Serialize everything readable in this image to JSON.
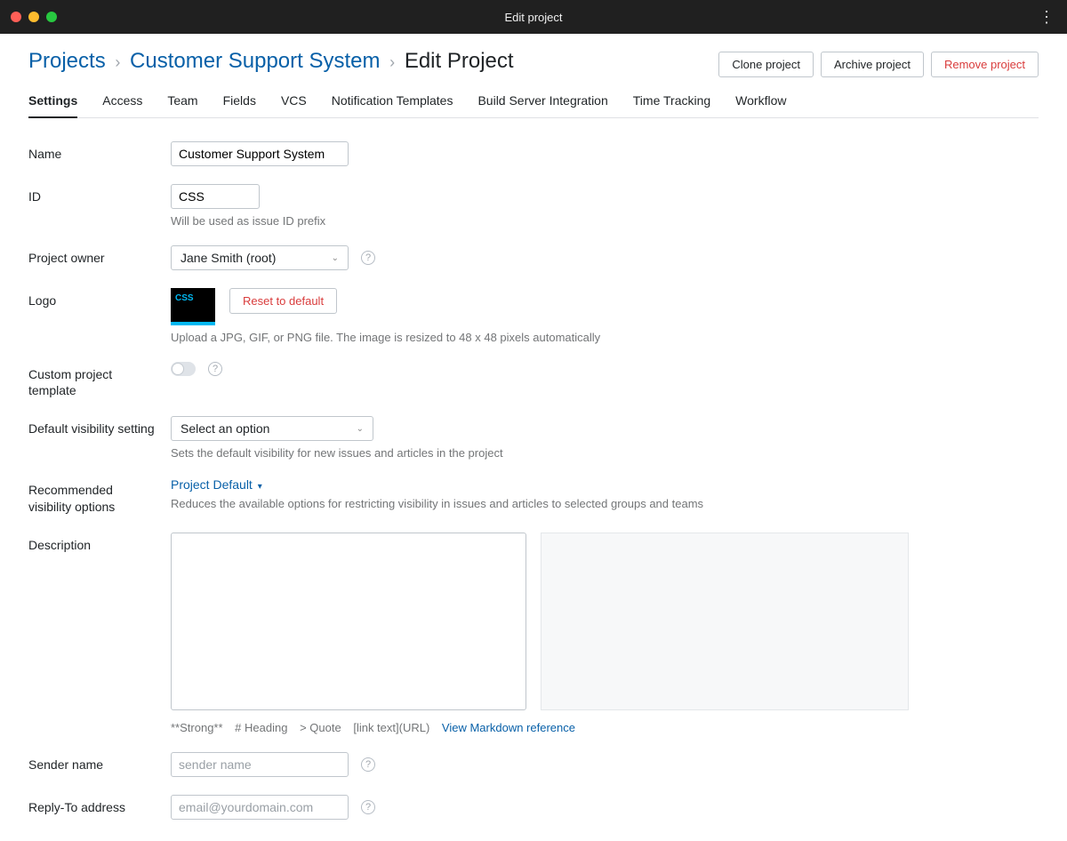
{
  "window": {
    "title": "Edit project"
  },
  "breadcrumb": {
    "root": "Projects",
    "project": "Customer Support System",
    "current": "Edit Project"
  },
  "actions": {
    "clone": "Clone project",
    "archive": "Archive project",
    "remove": "Remove project"
  },
  "tabs": [
    "Settings",
    "Access",
    "Team",
    "Fields",
    "VCS",
    "Notification Templates",
    "Build Server Integration",
    "Time Tracking",
    "Workflow"
  ],
  "active_tab_index": 0,
  "form": {
    "name": {
      "label": "Name",
      "value": "Customer Support System"
    },
    "id": {
      "label": "ID",
      "value": "CSS",
      "hint": "Will be used as issue ID prefix"
    },
    "owner": {
      "label": "Project owner",
      "value": "Jane Smith (root)"
    },
    "logo": {
      "label": "Logo",
      "tile_text": "CSS",
      "reset": "Reset to default",
      "hint": "Upload a JPG, GIF, or PNG file. The image is resized to 48 x 48 pixels automatically"
    },
    "custom_template": {
      "label": "Custom project template"
    },
    "default_visibility": {
      "label": "Default visibility setting",
      "placeholder": "Select an option",
      "hint": "Sets the default visibility for new issues and articles in the project"
    },
    "recommended_visibility": {
      "label": "Recommended visibility options",
      "value": "Project Default",
      "hint": "Reduces the available options for restricting visibility in issues and articles to selected groups and teams"
    },
    "description": {
      "label": "Description",
      "md_hints": {
        "strong": "**Strong**",
        "heading": "# Heading",
        "quote": "> Quote",
        "link": "[link text](URL)"
      },
      "md_reference": "View Markdown reference"
    },
    "sender_name": {
      "label": "Sender name",
      "placeholder": "sender name"
    },
    "reply_to": {
      "label": "Reply-To address",
      "placeholder": "email@yourdomain.com"
    }
  }
}
